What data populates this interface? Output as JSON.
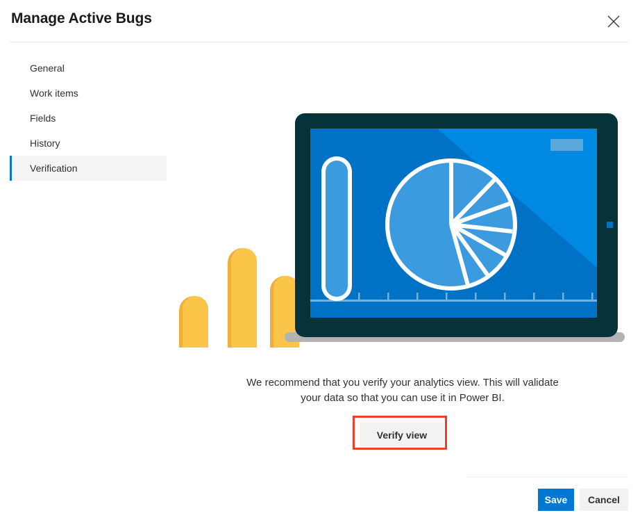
{
  "dialog": {
    "title": "Manage Active Bugs",
    "close_icon": "close-icon"
  },
  "sidebar": {
    "items": [
      {
        "label": "General",
        "selected": false
      },
      {
        "label": "Work items",
        "selected": false
      },
      {
        "label": "Fields",
        "selected": false
      },
      {
        "label": "History",
        "selected": false
      },
      {
        "label": "Verification",
        "selected": true
      }
    ]
  },
  "main": {
    "illustration": {
      "name": "analytics-tablet-illustration",
      "colors": {
        "bar_yellow": "#fbc54a",
        "bar_yellow_shade": "#efb03a",
        "tablet_frame": "#06323a",
        "screen_blue": "#0072c6",
        "screen_highlight": "#0089e0",
        "chart_blue": "#3c9ade",
        "outline_white": "#ffffff",
        "stand_gray": "#b3b3b3",
        "badge_blue": "#5ba8dd"
      }
    },
    "verify_text": "We recommend that you verify your analytics view. This will validate your data so that you can use it in Power BI.",
    "verify_button_label": "Verify view",
    "verify_button_highlight_color": "#e8402a"
  },
  "footer": {
    "save_label": "Save",
    "cancel_label": "Cancel",
    "save_color": "#0078d4"
  }
}
